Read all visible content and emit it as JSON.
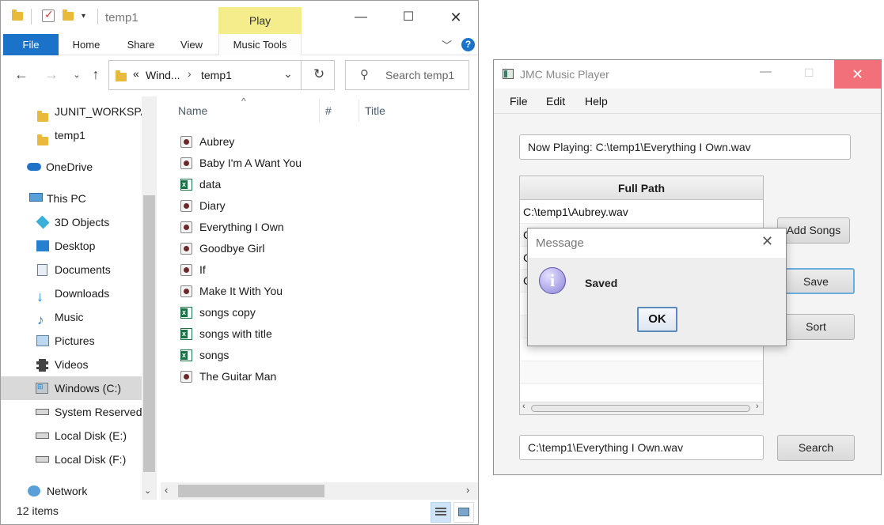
{
  "explorer": {
    "title": "temp1",
    "contextual_tab": "Play",
    "ribbon_tabs": [
      "File",
      "Home",
      "Share",
      "View",
      "Music Tools"
    ],
    "address": {
      "overflow": "«",
      "parent": "Wind...",
      "current": "temp1"
    },
    "search_placeholder": "Search temp1",
    "nav_items": [
      {
        "label": "JUNIT_WORKSPA",
        "icon": "folder-icon"
      },
      {
        "label": "temp1",
        "icon": "folder-icon"
      },
      {
        "label": "OneDrive",
        "icon": "cloud-icon"
      },
      {
        "label": "This PC",
        "icon": "computer-icon"
      },
      {
        "label": "3D Objects",
        "icon": "cube-icon"
      },
      {
        "label": "Desktop",
        "icon": "desktop-icon"
      },
      {
        "label": "Documents",
        "icon": "documents-icon"
      },
      {
        "label": "Downloads",
        "icon": "download-arrow-icon"
      },
      {
        "label": "Music",
        "icon": "music-note-icon"
      },
      {
        "label": "Pictures",
        "icon": "pictures-icon"
      },
      {
        "label": "Videos",
        "icon": "film-icon"
      },
      {
        "label": "Windows (C:)",
        "icon": "windows-drive-icon"
      },
      {
        "label": "System Reserved",
        "icon": "drive-icon"
      },
      {
        "label": "Local Disk (E:)",
        "icon": "drive-icon"
      },
      {
        "label": "Local Disk (F:)",
        "icon": "drive-icon"
      },
      {
        "label": "Network",
        "icon": "network-icon"
      }
    ],
    "columns": [
      "Name",
      "#",
      "Title"
    ],
    "files": [
      {
        "name": "Aubrey",
        "type": "audio"
      },
      {
        "name": "Baby I'm A Want You",
        "type": "audio"
      },
      {
        "name": "data",
        "type": "excel"
      },
      {
        "name": "Diary",
        "type": "audio"
      },
      {
        "name": "Everything I Own",
        "type": "audio"
      },
      {
        "name": "Goodbye Girl",
        "type": "audio"
      },
      {
        "name": "If",
        "type": "audio"
      },
      {
        "name": "Make It With You",
        "type": "audio"
      },
      {
        "name": "songs copy",
        "type": "excel"
      },
      {
        "name": "songs with title",
        "type": "excel"
      },
      {
        "name": "songs",
        "type": "excel"
      },
      {
        "name": "The Guitar Man",
        "type": "audio"
      }
    ],
    "status": "12 items",
    "selected_nav": "Windows (C:)"
  },
  "jmc": {
    "title": "JMC Music Player",
    "menu": [
      "File",
      "Edit",
      "Help"
    ],
    "now_playing": "Now Playing: C:\\temp1\\Everything I Own.wav",
    "table_header": "Full Path",
    "rows": [
      "C:\\temp1\\Aubrey.wav",
      "C",
      "C",
      "C"
    ],
    "buttons": {
      "add": "Add Songs",
      "save": "Save",
      "sort": "Sort",
      "search": "Search"
    },
    "search_value": "C:\\temp1\\Everything I Own.wav"
  },
  "dialog": {
    "title": "Message",
    "message": "Saved",
    "ok": "OK"
  }
}
